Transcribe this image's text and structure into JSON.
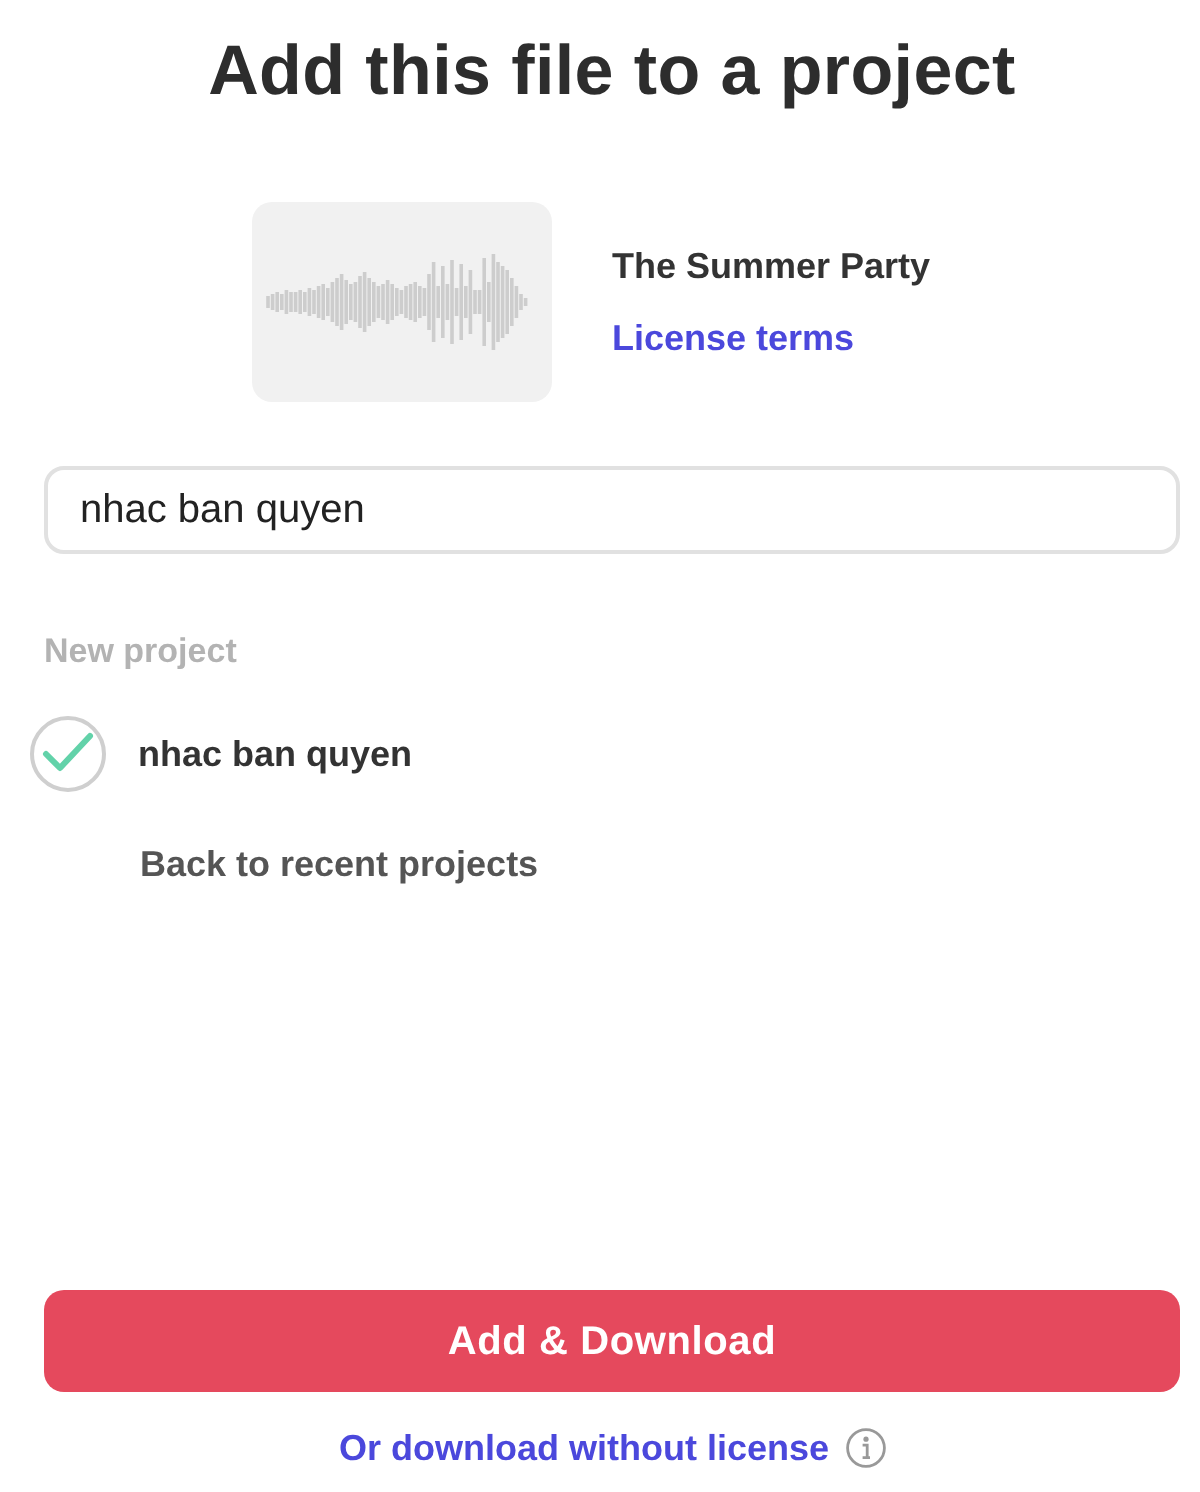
{
  "title": "Add this file to a project",
  "track": {
    "name": "The Summer Party",
    "license_link": "License terms"
  },
  "search": {
    "value": "nhac ban quyen"
  },
  "section_label": "New project",
  "projects": [
    {
      "name": "nhac ban quyen",
      "checked": true
    }
  ],
  "back_link": "Back to recent projects",
  "primary_button": "Add & Download",
  "secondary_link": "Or download without license"
}
